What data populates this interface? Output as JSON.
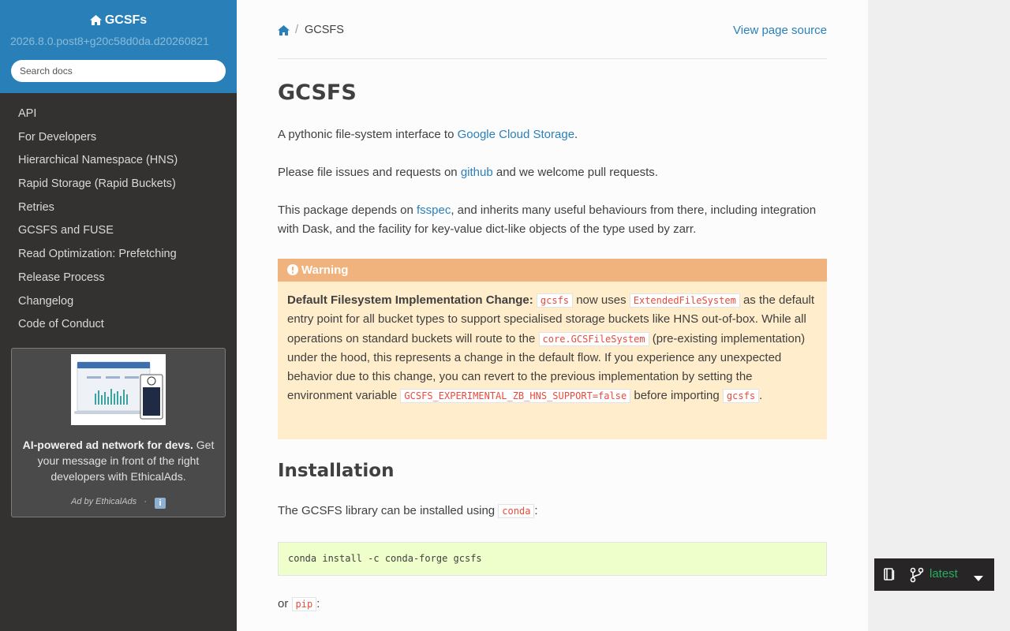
{
  "sidebar": {
    "project_name": "GCSFs",
    "version": "2026.8.0.post8+g20c58d0da.d20260821",
    "search_placeholder": "Search docs",
    "nav_items": [
      "API",
      "For Developers",
      "Hierarchical Namespace (HNS)",
      "Rapid Storage (Rapid Buckets)",
      "Retries",
      "GCSFS and FUSE",
      "Read Optimization: Prefetching",
      "Release Process",
      "Changelog",
      "Code of Conduct"
    ],
    "ad": {
      "bold_text": "AI-powered ad network for devs.",
      "text": " Get your message in front of the right developers with EthicalAds.",
      "by_text": "Ad by EthicalAds",
      "separator": "·",
      "info_icon": "info-icon"
    }
  },
  "breadcrumbs": {
    "home_icon": "home-icon",
    "separator": "/",
    "current": "GCSFS",
    "view_source": "View page source"
  },
  "page": {
    "title": "GCSFS",
    "p1": {
      "pre": "A pythonic file-system interface to ",
      "link": "Google Cloud Storage",
      "post": "."
    },
    "p2": {
      "pre": "Please file issues and requests on ",
      "link": "github",
      "post": " and we welcome pull requests."
    },
    "p3": {
      "pre": "This package depends on ",
      "link": "fsspec",
      "post": ", and inherits many useful behaviours from there, including integration with Dask, and the facility for key-value dict-like objects of the type used by zarr."
    },
    "warning": {
      "title": "Warning",
      "bold": "Default Filesystem Implementation Change:",
      "code1": "gcsfs",
      "t1": " now uses ",
      "code2": "ExtendedFileSystem",
      "t2": " as the default entry point for all bucket types to support specialised storage buckets like HNS out-of-box. While all operations on standard buckets will route to the ",
      "code3": "core.GCSFileSystem",
      "t3": " (pre-existing implementation) under the hood, this represents a change in the default flow. If you experience any unexpected behavior due to this change, you can revert to the previous implementation by setting the environment variable ",
      "code4": "GCSFS_EXPERIMENTAL_ZB_HNS_SUPPORT=false",
      "t4": " before importing ",
      "code5": "gcsfs",
      "t5": "."
    },
    "installation_heading": "Installation",
    "install_text": {
      "pre": "The GCSFS library can be installed using ",
      "code": "conda",
      "post": ":"
    },
    "conda_command": "conda install -c conda-forge gcsfs",
    "or_text": {
      "pre": "or ",
      "code": "pip",
      "post": ":"
    }
  },
  "version_switcher": {
    "book_icon": "book-icon",
    "branch_icon": "branch-icon",
    "label": "latest",
    "caret_icon": "caret-down-icon"
  },
  "colors": {
    "sidebar_bg": "#343131",
    "brand_blue": "#2980b9",
    "warning_header": "#f0b37e",
    "warning_bg": "#ffedcc",
    "code_red": "#e74c3c",
    "codeblock_bg": "#eeffcc",
    "latest_green": "#27ae60"
  }
}
